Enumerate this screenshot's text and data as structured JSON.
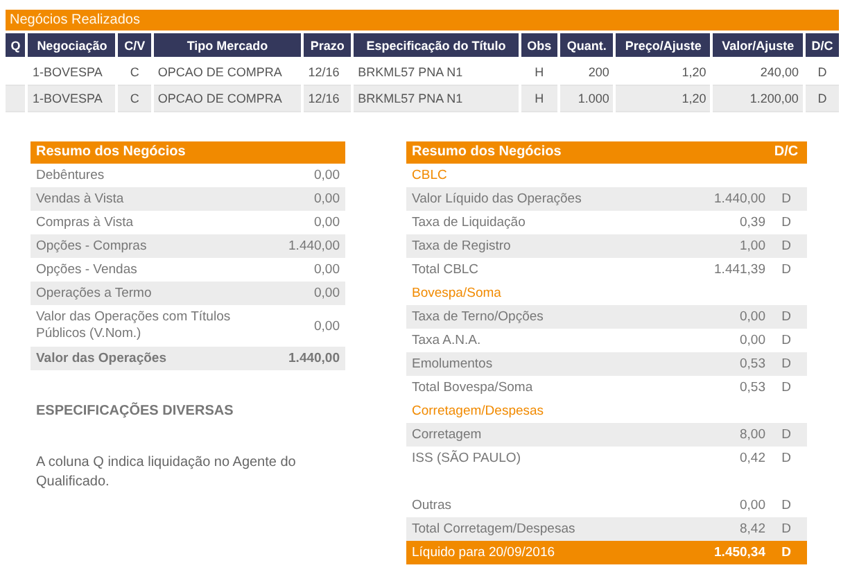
{
  "trades": {
    "title": "Negócios Realizados",
    "columns": [
      "Q",
      "Negociação",
      "C/V",
      "Tipo Mercado",
      "Prazo",
      "Especificação do Título",
      "Obs",
      "Quant.",
      "Preço/Ajuste",
      "Valor/Ajuste",
      "D/C"
    ],
    "rows": [
      {
        "cells": [
          "",
          "1-BOVESPA",
          "C",
          "OPCAO DE COMPRA",
          "12/16",
          "BRKML57 PNA N1",
          "H",
          "200",
          "1,20",
          "240,00",
          "D"
        ]
      },
      {
        "cells": [
          "",
          "1-BOVESPA",
          "C",
          "OPCAO DE COMPRA",
          "12/16",
          "BRKML57 PNA N1",
          "H",
          "1.000",
          "1,20",
          "1.200,00",
          "D"
        ]
      }
    ]
  },
  "summary_left": {
    "title": "Resumo dos Negócios",
    "rows": [
      {
        "kind": "row",
        "shaded": false,
        "label": "Debêntures",
        "value": "0,00"
      },
      {
        "kind": "row",
        "shaded": true,
        "label": "Vendas à Vista",
        "value": "0,00"
      },
      {
        "kind": "row",
        "shaded": false,
        "label": "Compras à Vista",
        "value": "0,00"
      },
      {
        "kind": "row",
        "shaded": true,
        "label": "Opções - Compras",
        "value": "1.440,00"
      },
      {
        "kind": "row",
        "shaded": false,
        "label": "Opções - Vendas",
        "value": "0,00"
      },
      {
        "kind": "row",
        "shaded": true,
        "label": "Operações a Termo",
        "value": "0,00"
      },
      {
        "kind": "row",
        "shaded": false,
        "label": "Valor das Operações com Títulos Públicos (V.Nom.)",
        "value": "0,00"
      },
      {
        "kind": "bold",
        "shaded": true,
        "label": "Valor das Operações",
        "value": "1.440,00"
      }
    ]
  },
  "specifications": {
    "title": "ESPECIFICAÇÕES DIVERSAS",
    "note": "A coluna Q indica liquidação no Agente do Qualificado."
  },
  "summary_right": {
    "title": "Resumo dos Negócios",
    "dc_label": "D/C",
    "rows": [
      {
        "kind": "section",
        "label": "CBLC"
      },
      {
        "kind": "row",
        "shaded": true,
        "label": "Valor Líquido das Operações",
        "value": "1.440,00",
        "dc": "D"
      },
      {
        "kind": "row",
        "shaded": false,
        "label": "Taxa de Liquidação",
        "value": "0,39",
        "dc": "D"
      },
      {
        "kind": "row",
        "shaded": true,
        "label": "Taxa de Registro",
        "value": "1,00",
        "dc": "D"
      },
      {
        "kind": "row",
        "shaded": false,
        "label": "Total CBLC",
        "value": "1.441,39",
        "dc": "D"
      },
      {
        "kind": "section",
        "label": "Bovespa/Soma"
      },
      {
        "kind": "row",
        "shaded": true,
        "label": "Taxa de Terno/Opções",
        "value": "0,00",
        "dc": "D"
      },
      {
        "kind": "row",
        "shaded": false,
        "label": "Taxa A.N.A.",
        "value": "0,00",
        "dc": "D"
      },
      {
        "kind": "row",
        "shaded": true,
        "label": "Emolumentos",
        "value": "0,53",
        "dc": "D"
      },
      {
        "kind": "row",
        "shaded": false,
        "label": "Total Bovespa/Soma",
        "value": "0,53",
        "dc": "D"
      },
      {
        "kind": "section",
        "label": "Corretagem/Despesas"
      },
      {
        "kind": "row",
        "shaded": true,
        "label": "Corretagem",
        "value": "8,00",
        "dc": "D"
      },
      {
        "kind": "row",
        "shaded": false,
        "label": "ISS (SÃO PAULO)",
        "value": "0,42",
        "dc": "D"
      },
      {
        "kind": "blank"
      },
      {
        "kind": "row",
        "shaded": false,
        "label": "Outras",
        "value": "0,00",
        "dc": "D"
      },
      {
        "kind": "row",
        "shaded": true,
        "label": "Total Corretagem/Despesas",
        "value": "8,42",
        "dc": "D"
      },
      {
        "kind": "total",
        "label": "Líquido para 20/09/2016",
        "value": "1.450,34",
        "dc": "D"
      }
    ]
  }
}
